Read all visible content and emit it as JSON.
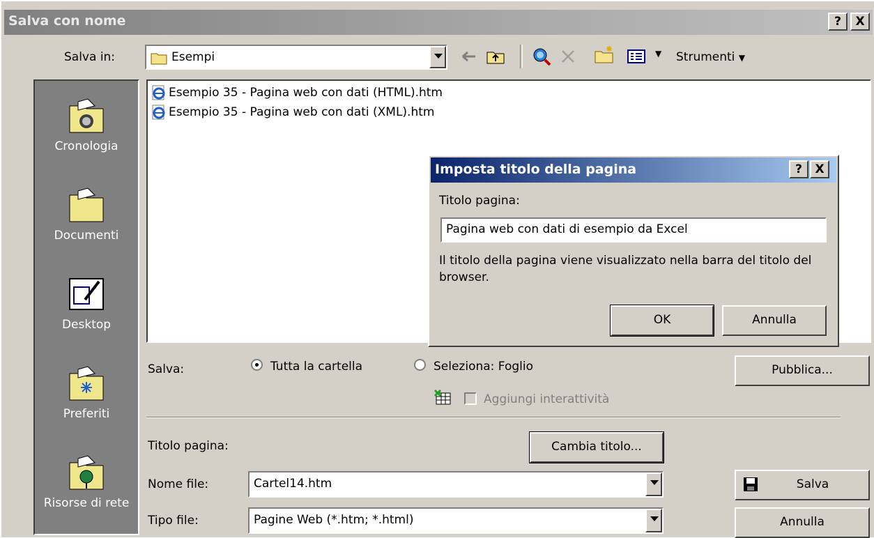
{
  "window": {
    "title": "Salva con nome",
    "help_btn": "?",
    "close_btn": "X"
  },
  "save_in": {
    "label": "Salva in:",
    "value": "Esempi"
  },
  "toolbar": {
    "tools_label": "Strumenti"
  },
  "places": [
    {
      "label": "Cronologia",
      "icon": "history-icon"
    },
    {
      "label": "Documenti",
      "icon": "my-documents-icon"
    },
    {
      "label": "Desktop",
      "icon": "desktop-icon"
    },
    {
      "label": "Preferiti",
      "icon": "favorites-icon"
    },
    {
      "label": "Risorse di rete",
      "icon": "network-icon"
    }
  ],
  "files": [
    "Esempio 35 - Pagina web con dati (HTML).htm",
    "Esempio 35 - Pagina web con dati (XML).htm"
  ],
  "save_options": {
    "label": "Salva:",
    "opt_all": "Tutta la cartella",
    "opt_selection": "Seleziona: Foglio",
    "interactivity": "Aggiungi interattività",
    "publish_btn": "Pubblica..."
  },
  "page_title": {
    "label": "Titolo pagina:",
    "change_btn": "Cambia titolo..."
  },
  "file_name": {
    "label": "Nome file:",
    "value": "Cartel14.htm"
  },
  "file_type": {
    "label": "Tipo file:",
    "value": "Pagine Web (*.htm; *.html)"
  },
  "actions": {
    "save": "Salva",
    "cancel": "Annulla"
  },
  "dialog": {
    "title": "Imposta titolo della pagina",
    "field_label": "Titolo pagina:",
    "field_value": "Pagina web con dati di esempio da Excel",
    "help_text": "Il titolo della pagina viene visualizzato nella barra del titolo del browser.",
    "ok": "OK",
    "cancel": "Annulla",
    "help_btn": "?",
    "close_btn": "X"
  }
}
